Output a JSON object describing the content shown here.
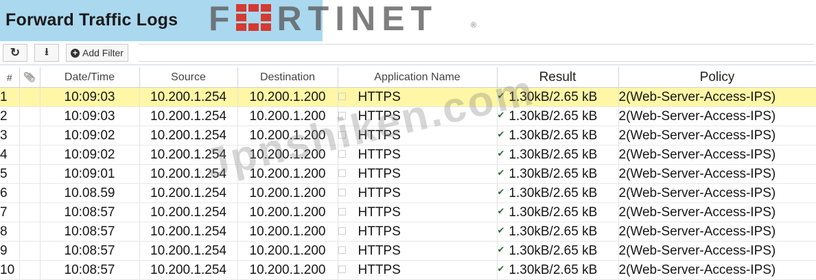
{
  "header": {
    "title": "Forward Traffic Logs",
    "logo_text": "FRTINET",
    "logo_reg": "®"
  },
  "toolbar": {
    "refresh_icon": "refresh-icon",
    "download_icon": "download-icon",
    "add_filter_label": "Add Filter"
  },
  "columns": [
    "#",
    "Date/Time",
    "Source",
    "Destination",
    "Application Name",
    "Result",
    "Policy"
  ],
  "rows": [
    {
      "n": "1",
      "time": "10:09:03",
      "source": "10.200.1.254",
      "destination": "10.200.1.200",
      "app": "HTTPS",
      "result": "1.30kB/2.65 kB",
      "policy": "2(Web-Server-Access-IPS)"
    },
    {
      "n": "2",
      "time": "10:09:03",
      "source": "10.200.1.254",
      "destination": "10.200.1.200",
      "app": "HTTPS",
      "result": "1.30kB/2.65 kB",
      "policy": "2(Web-Server-Access-IPS)"
    },
    {
      "n": "3",
      "time": "10:09:02",
      "source": "10.200.1.254",
      "destination": "10.200.1.200",
      "app": "HTTPS",
      "result": "1.30kB/2.65 kB",
      "policy": "2(Web-Server-Access-IPS)"
    },
    {
      "n": "4",
      "time": "10:09:02",
      "source": "10.200.1.254",
      "destination": "10.200.1.200",
      "app": "HTTPS",
      "result": "1.30kB/2.65 kB",
      "policy": "2(Web-Server-Access-IPS)"
    },
    {
      "n": "5",
      "time": "10:09:01",
      "source": "10.200.1.254",
      "destination": "10.200.1.200",
      "app": "HTTPS",
      "result": "1.30kB/2.65 kB",
      "policy": "2(Web-Server-Access-IPS)"
    },
    {
      "n": "6",
      "time": "10.08.59",
      "source": "10.200.1.254",
      "destination": "10.200.1.200",
      "app": "HTTPS",
      "result": "1.30kB/2.65 kB",
      "policy": "2(Web-Server-Access-IPS)"
    },
    {
      "n": "7",
      "time": "10:08:57",
      "source": "10.200.1.254",
      "destination": "10.200.1.200",
      "app": "HTTPS",
      "result": "1.30kB/2.65 kB",
      "policy": "2(Web-Server-Access-IPS)"
    },
    {
      "n": "8",
      "time": "10:08:57",
      "source": "10.200.1.254",
      "destination": "10.200.1.200",
      "app": "HTTPS",
      "result": "1.30kB/2.65 kB",
      "policy": "2(Web-Server-Access-IPS)"
    },
    {
      "n": "9",
      "time": "10:08:57",
      "source": "10.200.1.254",
      "destination": "10.200.1.200",
      "app": "HTTPS",
      "result": "1.30kB/2.65 kB",
      "policy": "2(Web-Server-Access-IPS)"
    },
    {
      "n": "10",
      "time": "10:08:57",
      "source": "10.200.1.254",
      "destination": "10.200.1.200",
      "app": "HTTPS",
      "result": "1.30kB/2.65 kB",
      "policy": "2(Web-Server-Access-IPS)"
    }
  ],
  "watermark": "Jpnshiken.com",
  "colors": {
    "title_bar": "#aad8ef",
    "selected_row": "#fff7a6",
    "logo_red": "#d33b33"
  }
}
